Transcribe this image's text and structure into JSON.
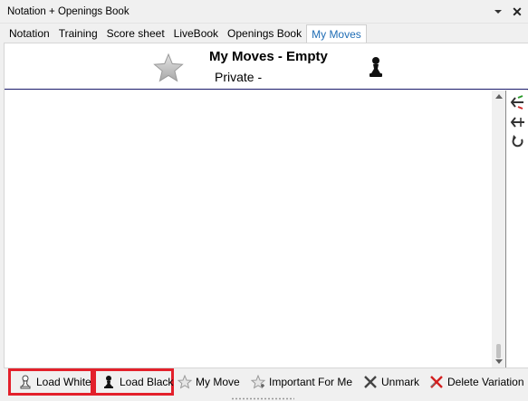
{
  "window": {
    "title": "Notation + Openings Book",
    "dropdown_icon": "chevron-down-icon",
    "close_icon": "close-icon",
    "close_glyph": "✕"
  },
  "tabs": [
    {
      "label": "Notation",
      "active": false
    },
    {
      "label": "Training",
      "active": false
    },
    {
      "label": "Score sheet",
      "active": false
    },
    {
      "label": "LiveBook",
      "active": false
    },
    {
      "label": "Openings Book",
      "active": false
    },
    {
      "label": "My Moves",
      "active": true
    }
  ],
  "header": {
    "title": "My Moves - Empty",
    "subtitle": "Private -",
    "star_icon": "star-icon",
    "pawn_icon": "black-pawn-icon"
  },
  "sidebar": {
    "items": [
      {
        "icon": "branch-arrows-icon"
      },
      {
        "icon": "merge-arrows-icon"
      },
      {
        "icon": "refresh-icon"
      }
    ]
  },
  "toolbar": {
    "buttons": [
      {
        "label": "Load White",
        "icon": "white-pawn-icon",
        "highlighted": true
      },
      {
        "label": "Load Black",
        "icon": "black-pawn-icon",
        "highlighted": true
      },
      {
        "label": "My Move",
        "icon": "star-outline-icon",
        "highlighted": false
      },
      {
        "label": "Important For Me",
        "icon": "star-plus-icon",
        "highlighted": false
      },
      {
        "label": "Unmark",
        "icon": "unmark-x-icon",
        "highlighted": false
      },
      {
        "label": "Delete Variation",
        "icon": "red-x-icon",
        "highlighted": false
      }
    ]
  },
  "colors": {
    "active_tab_text": "#1f6db5",
    "highlight_border": "#e3202b",
    "header_rule": "#1a1a6b"
  }
}
